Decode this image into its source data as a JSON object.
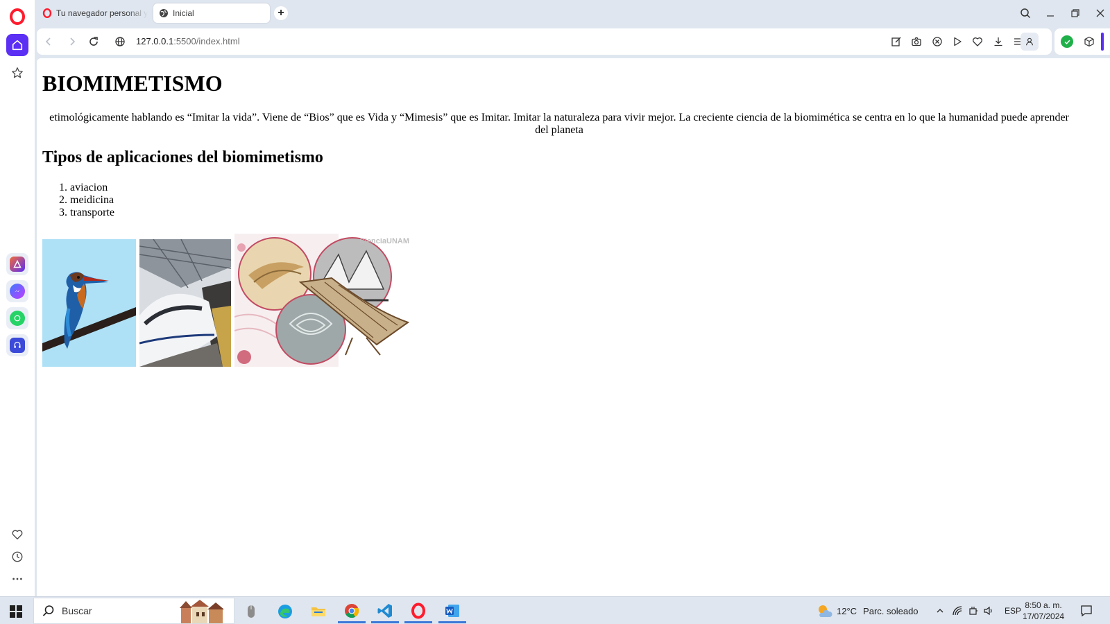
{
  "browser": {
    "tabs": [
      {
        "title": "Tu navegador personal ya"
      },
      {
        "title": "Inicial"
      }
    ],
    "new_tab_label": "+",
    "address": {
      "host": "127.0.0.1",
      "path": ":5500/index.html"
    },
    "brand_color": "#5b2ff4"
  },
  "page": {
    "title": "BIOMIMETISMO",
    "intro": "etimológicamente hablando es “Imitar la vida”. Viene de “Bios” que es Vida y “Mimesis” que es Imitar. Imitar la naturaleza para vivir mejor. La creciente ciencia de la biomimética se centra en lo que la humanidad puede aprender del planeta",
    "subtitle": "Tipos de aplicaciones del biomimetismo",
    "applications": [
      "aviacion",
      "meidicina",
      "transporte"
    ],
    "images": [
      {
        "name": "kingfisher-bird-photo"
      },
      {
        "name": "bullet-train-photo"
      },
      {
        "name": "biomimicry-collage",
        "watermark": "CienciaUNAM"
      }
    ]
  },
  "taskbar": {
    "search_placeholder": "Buscar",
    "weather": {
      "temp": "12°C",
      "desc": "Parc. soleado"
    },
    "language": "ESP",
    "time": "8:50 a. m.",
    "date": "17/07/2024"
  }
}
